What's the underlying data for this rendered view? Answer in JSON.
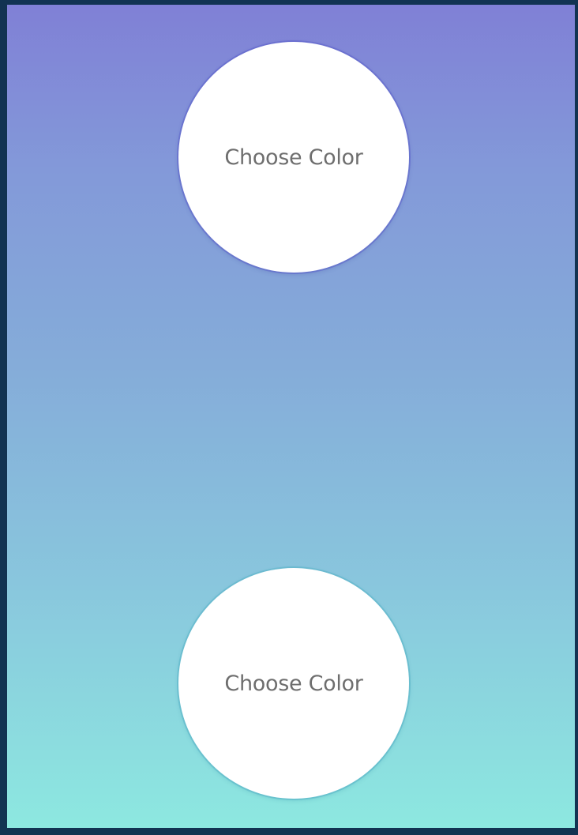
{
  "screen": {
    "background_gradient": [
      "#8080d6",
      "#8de8e0"
    ],
    "frame_color": "#123352"
  },
  "top_picker": {
    "label": "Choose Color"
  },
  "bottom_picker": {
    "label": "Choose Color"
  }
}
